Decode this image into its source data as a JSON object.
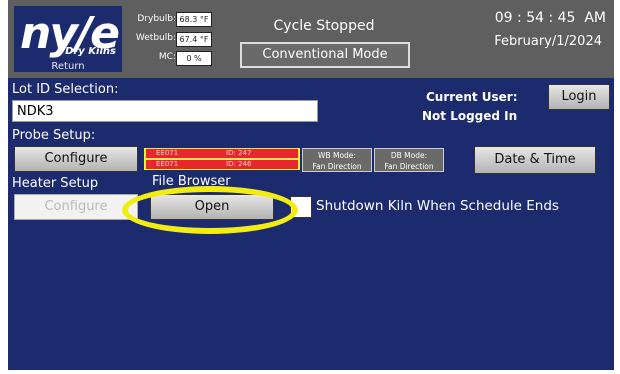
{
  "logo": {
    "brand": "ny/e",
    "subtitle": "Dry Kilns",
    "return_label": "Return"
  },
  "readings": [
    {
      "label": "Drybulb:",
      "value": "68.3 °F"
    },
    {
      "label": "Wetbulb:",
      "value": "67.4 °F"
    },
    {
      "label": "MC:",
      "value": "0 %"
    }
  ],
  "status": {
    "cycle": "Cycle Stopped",
    "mode": "Conventional Mode"
  },
  "clock": {
    "time": "09 : 54 : 45  AM",
    "date": "February/1/2024"
  },
  "lot": {
    "label": "Lot ID Selection:",
    "value": "NDK3"
  },
  "user": {
    "label": "Current User:",
    "status": "Not Logged In",
    "login_button": "Login"
  },
  "probe": {
    "label": "Probe Setup:",
    "configure_button": "Configure",
    "probes": [
      {
        "name": "EE071",
        "id": "ID:  247"
      },
      {
        "name": "EE071",
        "id": "ID:  246"
      }
    ],
    "wb_mode": {
      "title": "WB Mode:",
      "value": "Fan Direction"
    },
    "db_mode": {
      "title": "DB Mode:",
      "value": "Fan Direction"
    },
    "date_time_button": "Date & Time"
  },
  "heater": {
    "label": "Heater Setup",
    "configure_button": "Configure"
  },
  "file_browser": {
    "label": "File Browser",
    "open_button": "Open"
  },
  "shutdown": {
    "label": "Shutdown Kiln When Schedule Ends",
    "checked": false
  },
  "colors": {
    "panel": "#1c2a6e",
    "header": "#5f5f5f",
    "highlight": "#f3ec12",
    "probe_red": "#e8262f"
  }
}
